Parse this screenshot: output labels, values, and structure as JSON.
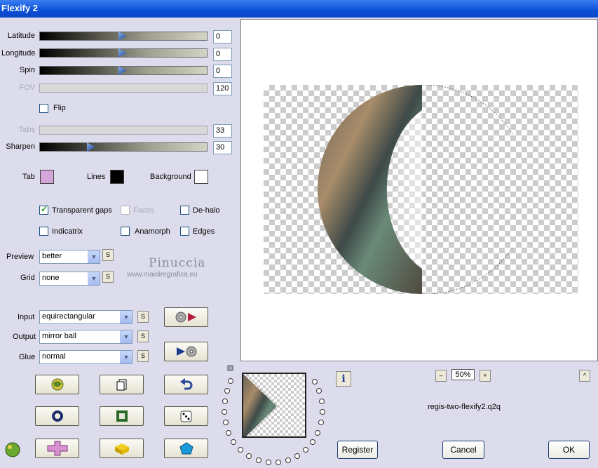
{
  "window": {
    "title": "Flexify 2"
  },
  "sliders": {
    "latitude": {
      "label": "Latitude",
      "value": "0",
      "level": 0.5
    },
    "longitude": {
      "label": "Longitude",
      "value": "0",
      "level": 0.5
    },
    "spin": {
      "label": "Spin",
      "value": "0",
      "level": 0.5
    },
    "fov": {
      "label": "FOV",
      "value": "120"
    },
    "tabs": {
      "label": "Tabs",
      "value": "33"
    },
    "sharpen": {
      "label": "Sharpen",
      "value": "30",
      "level": 0.3
    }
  },
  "flip": {
    "label": "Flip",
    "checked": false
  },
  "colors": {
    "tab": {
      "label": "Tab",
      "color": "#d4a6d9"
    },
    "lines": {
      "label": "Lines",
      "color": "#000000"
    },
    "background": {
      "label": "Background",
      "color": "#ffffff"
    }
  },
  "options": {
    "transparent_gaps": {
      "label": "Transparent gaps",
      "checked": true
    },
    "faces": {
      "label": "Faces",
      "checked": false
    },
    "de_halo": {
      "label": "De-halo",
      "checked": false
    },
    "indicatrix": {
      "label": "Indicatrix",
      "checked": false
    },
    "anamorph": {
      "label": "Anamorph",
      "checked": false
    },
    "edges": {
      "label": "Edges",
      "checked": false
    }
  },
  "preview": {
    "label": "Preview",
    "value": "better"
  },
  "grid": {
    "label": "Grid",
    "value": "none"
  },
  "input": {
    "label": "Input",
    "value": "equirectangular"
  },
  "output": {
    "label": "Output",
    "value": "mirror ball"
  },
  "glue": {
    "label": "Glue",
    "value": "normal"
  },
  "s_label": "S",
  "watermark": {
    "name": "Pinuccia",
    "url": "www.maidiregrafica.eu"
  },
  "zoom": {
    "value": "50%",
    "minus": "–",
    "plus": "+"
  },
  "filename": "regis-two-flexify2.q2q",
  "info_label": "i",
  "collapse_label": "^",
  "buttons": {
    "register": "Register",
    "cancel": "Cancel",
    "ok": "OK"
  },
  "icons": [
    "disc-play-icon",
    "play-disc-icon",
    "globe-icon",
    "page-icon",
    "undo-icon",
    "ring-icon",
    "frame-icon",
    "dice-icon",
    "cross-icon",
    "brick-icon",
    "gem-icon",
    "plugin-logo-icon"
  ]
}
